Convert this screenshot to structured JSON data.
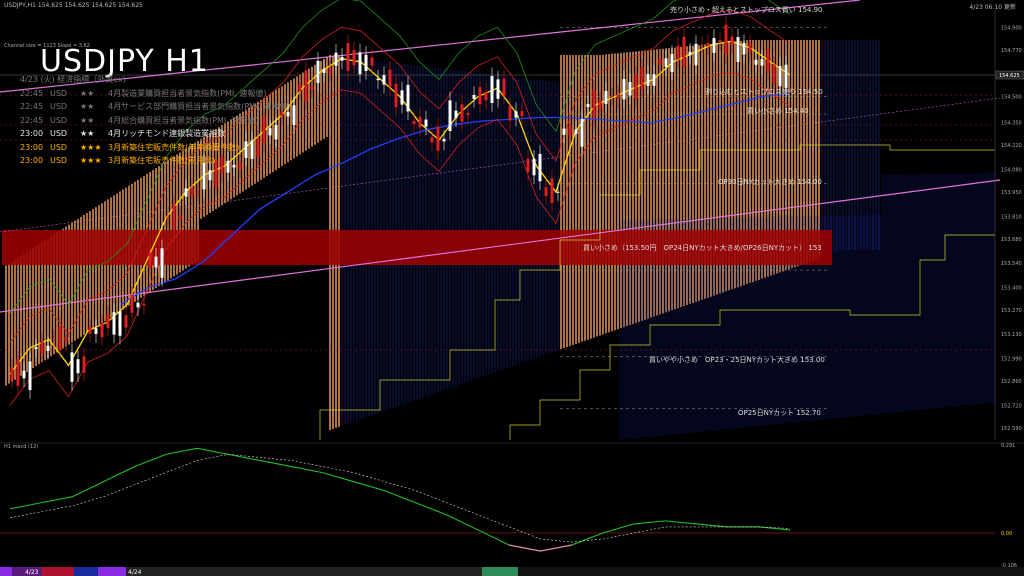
{
  "header": {
    "left": "USDJPY,H1  154.625 154.625 154.625 154.625",
    "right": "4/23 06:10 更新"
  },
  "channel_info": "Channel size = 1123  Slope = 3.62",
  "symbol_title": "USDJPY H1",
  "events_heading": "4/23 (火) 経済指標（外資ex)",
  "events": [
    {
      "time": "22:45",
      "cur": "USD",
      "stars": "★★",
      "text": "4月製造業購買担当者景気指数(PMI, 速報値)",
      "style": "grey"
    },
    {
      "time": "22:45",
      "cur": "USD",
      "stars": "★★",
      "text": "4月サービス部門購買担当者景気指数(PMI, 速報値)",
      "style": "grey"
    },
    {
      "time": "22:45",
      "cur": "USD",
      "stars": "★★",
      "text": "4月総合購買担当者景気指数(PMI, 速報値)",
      "style": "grey"
    },
    {
      "time": "23:00",
      "cur": "USD",
      "stars": "★★",
      "text": "4月リッチモンド連銀製造業指数",
      "style": "white"
    },
    {
      "time": "23:00",
      "cur": "USD",
      "stars": "★★★",
      "text": "3月新築住宅販売件数(年率換算件数)",
      "style": "gold"
    },
    {
      "time": "23:00",
      "cur": "USD",
      "stars": "★★★",
      "text": "3月新築住宅販売件数(前月比)",
      "style": "gold"
    }
  ],
  "annotations": [
    {
      "id": "sell-small-stop",
      "text": "売り小さめ・超えるとストップロス買い 154.90"
    },
    {
      "id": "stop-sell",
      "text": "割り込むとストップロス売り 154.50"
    },
    {
      "id": "buy-small",
      "text": "買い小さめ 154.40"
    },
    {
      "id": "op30-cut",
      "text": "OP30日NYカット大きめ 154.00"
    },
    {
      "id": "buy-zone",
      "text": "買い小さめ（153.50円　OP24日NYカット大きめ/OP26日NYカット） 153"
    },
    {
      "id": "buy-op23",
      "text": "買いやや小さめ　OP23・25日NYカット大きめ 153.00"
    },
    {
      "id": "op25-cut",
      "text": "OP25日NYカット 152.70"
    }
  ],
  "price_axis": [
    "154.900",
    "154.770",
    "154.630",
    "154.500",
    "154.350",
    "154.220",
    "154.080",
    "153.950",
    "153.810",
    "153.680",
    "153.540",
    "153.400",
    "153.270",
    "153.130",
    "152.990",
    "152.860",
    "152.720",
    "152.590"
  ],
  "current_price": "154.625",
  "macd_label": "H1 macd (12)",
  "macd_axis": [
    "0.291",
    "0.00",
    "-0.106"
  ],
  "bottom_labels": [
    "4/23",
    "4/24"
  ],
  "chart_data": [
    {
      "type": "line",
      "title": "USDJPY H1",
      "ylim": [
        152.52,
        155.0
      ],
      "series": [
        {
          "values": [
            152.9,
            153.05,
            153.1,
            152.95,
            153.15,
            153.2,
            153.3,
            153.55,
            153.8,
            153.95,
            154.05,
            154.1,
            154.2,
            154.3,
            154.4,
            154.55,
            154.65,
            154.72,
            154.7,
            154.6,
            154.5,
            154.35,
            154.25,
            154.4,
            154.5,
            154.55,
            154.4,
            154.1,
            153.95,
            154.3,
            154.45,
            154.5,
            154.55,
            154.6,
            154.7,
            154.75,
            154.8,
            154.82,
            154.78,
            154.7,
            154.625
          ]
        },
        {
          "values": [
            153.3,
            153.4,
            153.45,
            153.55,
            153.7,
            153.85,
            153.95,
            154.05,
            154.12,
            154.2,
            154.26,
            154.31,
            154.34,
            154.36,
            154.37,
            154.38,
            154.38,
            154.37,
            154.36,
            154.35,
            154.38,
            154.42,
            154.46,
            154.5,
            154.52
          ]
        }
      ],
      "levels": [
        154.9,
        154.5,
        154.4,
        154.0,
        153.5,
        153.0,
        152.7
      ]
    },
    {
      "type": "line",
      "title": "H1 macd (12)",
      "ylim": [
        -0.106,
        0.291
      ],
      "series": [
        {
          "values": [
            0.08,
            0.1,
            0.12,
            0.17,
            0.22,
            0.26,
            0.28,
            0.26,
            0.24,
            0.22,
            0.2,
            0.17,
            0.14,
            0.1,
            0.06,
            0.01,
            -0.04,
            -0.06,
            -0.04,
            0.0,
            0.03,
            0.04,
            0.03,
            0.02,
            0.02,
            0.01
          ]
        },
        {
          "values": [
            0.05,
            0.07,
            0.09,
            0.12,
            0.16,
            0.2,
            0.24,
            0.26,
            0.25,
            0.24,
            0.22,
            0.2,
            0.17,
            0.14,
            0.1,
            0.06,
            0.02,
            -0.02,
            -0.03,
            -0.02,
            0.0,
            0.02,
            0.02,
            0.02,
            0.02,
            0.015
          ]
        }
      ]
    }
  ]
}
